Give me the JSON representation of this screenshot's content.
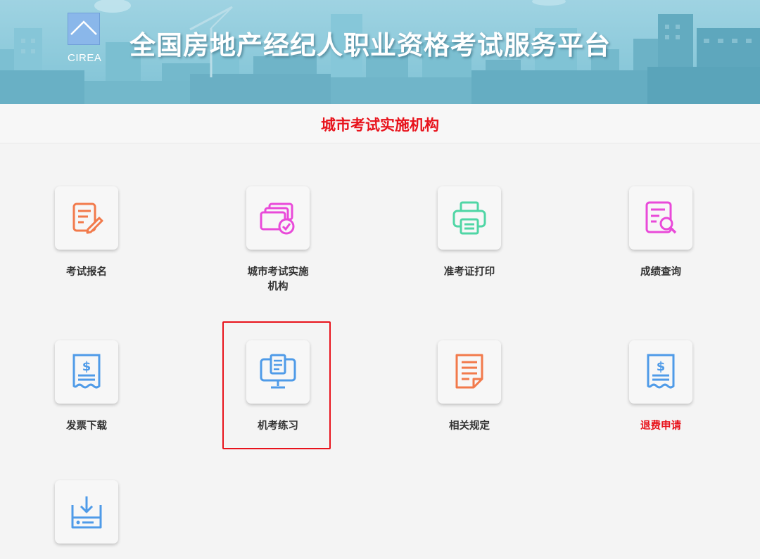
{
  "header": {
    "logo_text": "CIREA",
    "site_title": "全国房地产经纪人职业资格考试服务平台"
  },
  "section": {
    "title": "城市考试实施机构"
  },
  "tiles": [
    {
      "label": "考试报名",
      "icon": "registration-form-icon",
      "color": "#f27a4b"
    },
    {
      "label": "城市考试实施机构",
      "icon": "certificate-cards-icon",
      "color": "#e94ad9"
    },
    {
      "label": "准考证打印",
      "icon": "printer-icon",
      "color": "#4fd6a5"
    },
    {
      "label": "成绩查询",
      "icon": "document-search-icon",
      "color": "#e94ad9"
    },
    {
      "label": "发票下载",
      "icon": "invoice-icon",
      "color": "#4f9be8"
    },
    {
      "label": "机考练习",
      "icon": "computer-practice-icon",
      "color": "#4f9be8"
    },
    {
      "label": "相关规定",
      "icon": "regulations-document-icon",
      "color": "#f27a4b"
    },
    {
      "label": "退费申请",
      "icon": "refund-receipt-icon",
      "color": "#4f9be8",
      "label_color": "#e8131c"
    },
    {
      "label": "",
      "icon": "download-tray-icon",
      "color": "#4f9be8"
    }
  ],
  "highlight_color": "#e8131c"
}
